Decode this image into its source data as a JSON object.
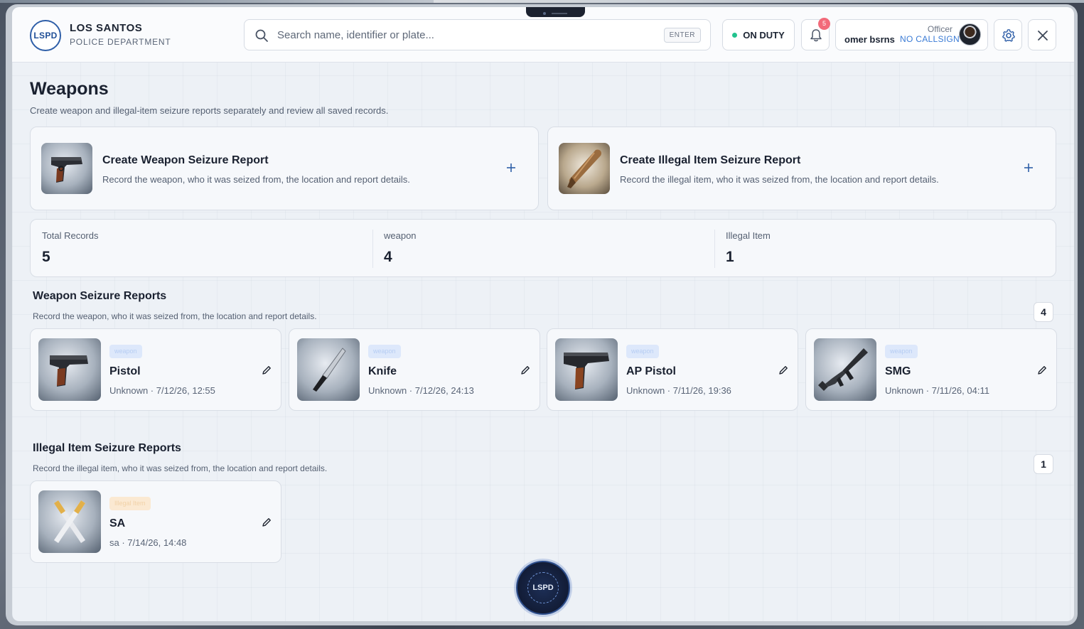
{
  "brand": {
    "logo_text": "LSPD",
    "title": "LOS SANTOS",
    "subtitle": "POLICE DEPARTMENT"
  },
  "search": {
    "placeholder": "Search name, identifier or plate...",
    "key_hint": "ENTER"
  },
  "status": {
    "label": "ON DUTY",
    "color": "#22c38e"
  },
  "notifications": {
    "count": "5",
    "icon": "bell-icon"
  },
  "officer": {
    "role": "Officer",
    "name": "omer bsrns",
    "callsign": "NO CALLSIGN"
  },
  "page": {
    "title": "Weapons",
    "subtitle": "Create weapon and illegal-item seizure reports separately and review all saved records."
  },
  "create_cards": [
    {
      "title": "Create Weapon Seizure Report",
      "description": "Record the weapon, who it was seized from, the location and report details."
    },
    {
      "title": "Create Illegal Item Seizure Report",
      "description": "Record the illegal item, who it was seized from, the location and report details."
    }
  ],
  "stats": [
    {
      "label": "Total Records",
      "value": "5"
    },
    {
      "label": "weapon",
      "value": "4"
    },
    {
      "label": "Illegal Item",
      "value": "1"
    }
  ],
  "weapon_section": {
    "title": "Weapon Seizure Reports",
    "subtitle": "Record the weapon, who it was seized from, the location and report details.",
    "count": "4",
    "records": [
      {
        "tag": "weapon",
        "name": "Pistol",
        "meta": "Unknown · 7/12/26, 12:55"
      },
      {
        "tag": "weapon",
        "name": "Knife",
        "meta": "Unknown · 7/12/26, 24:13"
      },
      {
        "tag": "weapon",
        "name": "AP Pistol",
        "meta": "Unknown · 7/11/26, 19:36"
      },
      {
        "tag": "weapon",
        "name": "SMG",
        "meta": "Unknown · 7/11/26, 04:11"
      }
    ]
  },
  "illegal_section": {
    "title": "Illegal Item Seizure Reports",
    "subtitle": "Record the illegal item, who it was seized from, the location and report details.",
    "count": "1",
    "records": [
      {
        "tag": "Illegal Item",
        "name": "SA",
        "meta": "sa · 7/14/26, 14:48"
      }
    ]
  },
  "fab": {
    "logo_text": "LSPD"
  },
  "colors": {
    "accent": "#3a7bd5",
    "badge": "#f26a7a",
    "brand": "#1f4e96"
  }
}
